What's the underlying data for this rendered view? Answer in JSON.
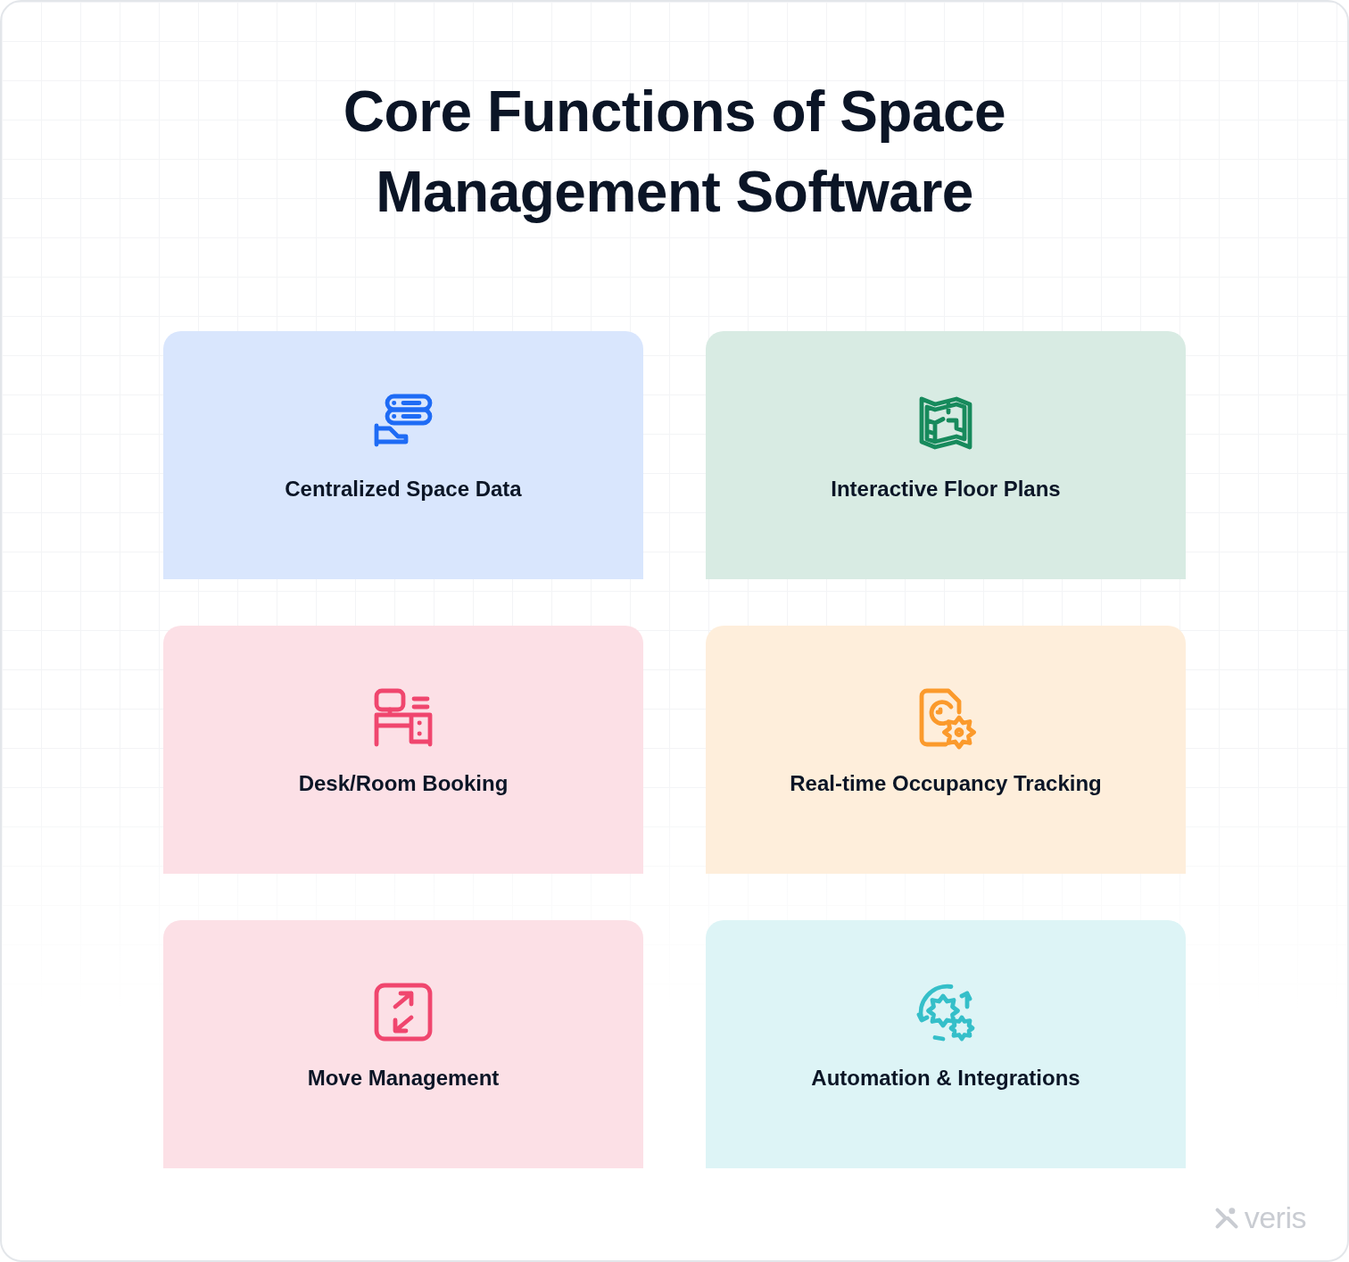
{
  "title": "Core Functions of Space Management Software",
  "cards": [
    {
      "kind": "data",
      "label": "Centralized Space Data",
      "color": "#1e6bf5"
    },
    {
      "kind": "map",
      "label": "Interactive Floor Plans",
      "color": "#178a5c"
    },
    {
      "kind": "desk",
      "label": "Desk/Room Booking",
      "color": "#f0466e"
    },
    {
      "kind": "tracking",
      "label": "Real-time Occupancy Tracking",
      "color": "#fb9a2c"
    },
    {
      "kind": "move",
      "label": "Move Management",
      "color": "#f0466e"
    },
    {
      "kind": "automation",
      "label": "Automation & Integrations",
      "color": "#35bfc9"
    }
  ],
  "brand": "veris"
}
